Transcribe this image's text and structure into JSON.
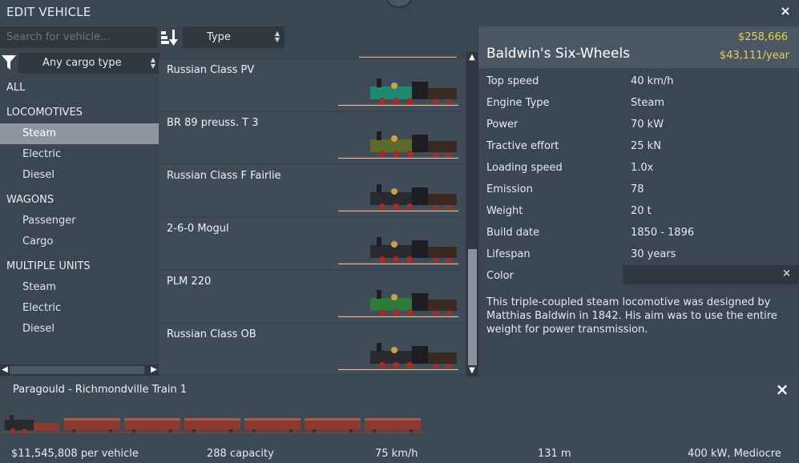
{
  "window": {
    "title": "EDIT VEHICLE",
    "close_icon": "×"
  },
  "search": {
    "placeholder": "Search for vehicle..."
  },
  "sort": {
    "type_label": "Type"
  },
  "cargo_filter": {
    "label": "Any cargo type"
  },
  "categories": [
    {
      "label": "ALL",
      "kind": "header"
    },
    {
      "label": "LOCOMOTIVES",
      "kind": "header"
    },
    {
      "label": "Steam",
      "kind": "item",
      "selected": true
    },
    {
      "label": "Electric",
      "kind": "item"
    },
    {
      "label": "Diesel",
      "kind": "item"
    },
    {
      "label": "WAGONS",
      "kind": "header"
    },
    {
      "label": "Passenger",
      "kind": "item"
    },
    {
      "label": "Cargo",
      "kind": "item"
    },
    {
      "label": "MULTIPLE UNITS",
      "kind": "header"
    },
    {
      "label": "Steam",
      "kind": "item"
    },
    {
      "label": "Electric",
      "kind": "item"
    },
    {
      "label": "Diesel",
      "kind": "item"
    }
  ],
  "vehicles": [
    {
      "name": "Russian Class PV",
      "color": "#1f8a72"
    },
    {
      "name": "BR 89 preuss. T 3",
      "color": "#5c6a2a"
    },
    {
      "name": "Russian Class F Fairlie",
      "color": "#2a2a2e"
    },
    {
      "name": "2-6-0 Mogul",
      "color": "#2a2a2e"
    },
    {
      "name": "PLM 220",
      "color": "#2e7a3a"
    },
    {
      "name": "Russian Class OB",
      "color": "#2a2a2e"
    }
  ],
  "detail": {
    "title": "Baldwin's Six-Wheels",
    "price": "$258,666",
    "upkeep": "$43,111/year",
    "specs": [
      {
        "key": "Top speed",
        "value": "40 km/h"
      },
      {
        "key": "Engine Type",
        "value": "Steam"
      },
      {
        "key": "Power",
        "value": "70 kW"
      },
      {
        "key": "Tractive effort",
        "value": "25 kN"
      },
      {
        "key": "Loading speed",
        "value": "1.0x"
      },
      {
        "key": "Emission",
        "value": "78"
      },
      {
        "key": "Weight",
        "value": "20 t"
      },
      {
        "key": "Build date",
        "value": "1850 - 1896"
      },
      {
        "key": "Lifespan",
        "value": "30 years"
      }
    ],
    "color_label": "Color",
    "color_clear": "×",
    "description": "This triple-coupled steam locomotive was designed by Matthias Baldwin in 1842. His aim was to use the entire weight for power transmission."
  },
  "train": {
    "name": "Paragould - Richmondville Train 1",
    "close_icon": "×",
    "stats": {
      "cost": "$11,545,808 per vehicle",
      "capacity": "288 capacity",
      "speed": "75 km/h",
      "length": "131 m",
      "power": "400 kW, Mediocre"
    },
    "wagon_count": 6
  },
  "colors": {
    "accent_money": "#e3cf58",
    "selected_bg": "#8d969e",
    "panel_bg": "#3a4651"
  },
  "icons": [
    "close-icon",
    "sort-icon",
    "filter-icon",
    "dropdown-arrows-icon",
    "scroll-left-icon",
    "scroll-right-icon",
    "scroll-up-icon",
    "scroll-down-icon"
  ]
}
